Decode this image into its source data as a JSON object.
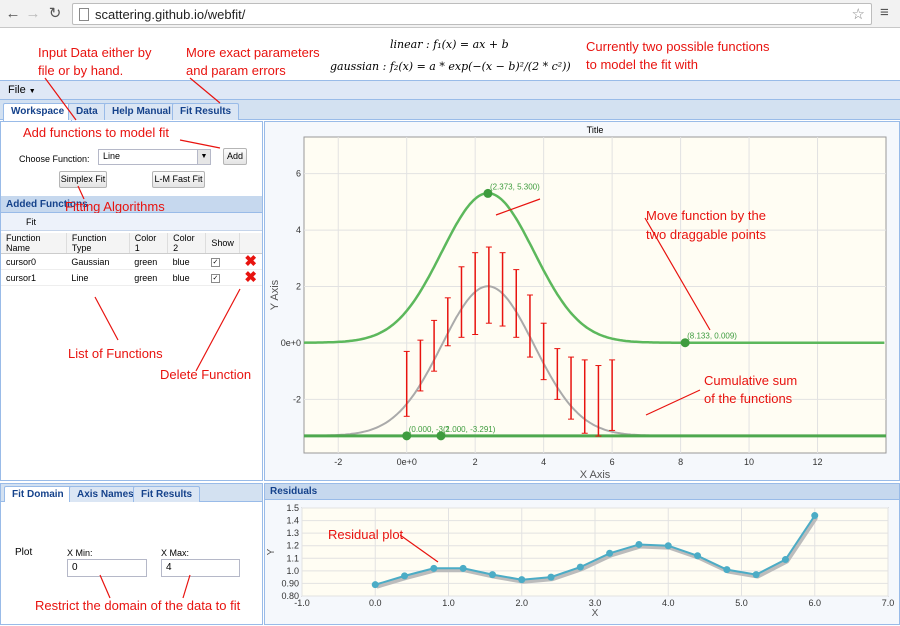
{
  "browser": {
    "url": "scattering.github.io/webfit/"
  },
  "formulas": {
    "linear": "linear : f₁(x) = ax + b",
    "gaussian": "gaussian : f₂(x) = a * exp(−(x − b)²/(2 * c²))"
  },
  "annotations": {
    "input_data_1": "Input Data either by",
    "input_data_2": "file or by hand.",
    "params_1": "More exact parameters",
    "params_2": "and param errors",
    "functions_1": "Currently two possible functions",
    "functions_2": "to model the fit with",
    "add_functions": "Add functions to model fit",
    "fitting_algorithms": "Fitting Algorithms",
    "list_functions": "List of Functions",
    "delete_function": "Delete Function",
    "move_function_1": "Move function by the",
    "move_function_2": "two draggable points",
    "cumulative_1": "Cumulative sum",
    "cumulative_2": "of the functions",
    "residual_plot": "Residual plot",
    "restrict_domain": "Restrict the domain of the data to fit"
  },
  "menu": {
    "file": "File"
  },
  "tabs": [
    "Workspace",
    "Data",
    "Help Manual",
    "Fit Results"
  ],
  "workspace": {
    "choose_function_label": "Choose Function:",
    "choose_function_value": "Line",
    "add_button": "Add",
    "simplex_button": "Simplex Fit",
    "lm_button": "L-M Fast Fit",
    "added_functions_title": "Added Functions",
    "fit_label": "Fit",
    "columns": [
      "Function Name",
      "Function Type",
      "Color 1",
      "Color 2",
      "Show"
    ],
    "rows": [
      {
        "name": "cursor0",
        "type": "Gaussian",
        "color1": "green",
        "color2": "blue"
      },
      {
        "name": "cursor1",
        "type": "Line",
        "color1": "green",
        "color2": "blue"
      }
    ]
  },
  "bottom_tabs": [
    "Fit Domain",
    "Axis Names",
    "Fit Results"
  ],
  "fit_domain": {
    "plot_label": "Plot",
    "xmin_label": "X Min:",
    "xmin_value": "0",
    "xmax_label": "X Max:",
    "xmax_value": "4"
  },
  "residuals_title": "Residuals",
  "colors": {
    "accent": "#15428b",
    "annotation": "#e8130f",
    "gaussian": "#5cb85c",
    "datapoints": "#e8130f",
    "residual": "#4bacc6"
  },
  "chart_data": [
    {
      "type": "scatter",
      "title": "Title",
      "xlabel": "X Axis",
      "ylabel": "Y Axis",
      "xlim": [
        -3,
        14
      ],
      "ylim": [
        -3.9,
        7.3
      ],
      "xticks": [
        "-2",
        "0e+0",
        "2",
        "4",
        "6",
        "8",
        "10",
        "12"
      ],
      "xtick_values": [
        -2,
        0,
        2,
        4,
        6,
        8,
        10,
        12
      ],
      "yticks": [
        "-2",
        "0e+0",
        "2",
        "4",
        "6"
      ],
      "ytick_values": [
        -2,
        0,
        2,
        4,
        6
      ],
      "grid": true,
      "errorbars": [
        {
          "x": 0.0,
          "ylow": -2.6,
          "yhigh": -0.3
        },
        {
          "x": 0.4,
          "ylow": -1.7,
          "yhigh": 0.1
        },
        {
          "x": 0.8,
          "ylow": -1.0,
          "yhigh": 0.8
        },
        {
          "x": 1.2,
          "ylow": -0.1,
          "yhigh": 1.6
        },
        {
          "x": 1.6,
          "ylow": 0.2,
          "yhigh": 2.7
        },
        {
          "x": 2.0,
          "ylow": 0.3,
          "yhigh": 3.2
        },
        {
          "x": 2.4,
          "ylow": 0.7,
          "yhigh": 3.4
        },
        {
          "x": 2.8,
          "ylow": 0.6,
          "yhigh": 3.2
        },
        {
          "x": 3.2,
          "ylow": 0.2,
          "yhigh": 2.6
        },
        {
          "x": 3.6,
          "ylow": -0.5,
          "yhigh": 1.7
        },
        {
          "x": 4.0,
          "ylow": -1.3,
          "yhigh": 0.7
        },
        {
          "x": 4.4,
          "ylow": -2.0,
          "yhigh": -0.2
        },
        {
          "x": 4.8,
          "ylow": -2.7,
          "yhigh": -0.5
        },
        {
          "x": 5.2,
          "ylow": -3.2,
          "yhigh": -0.6
        },
        {
          "x": 5.6,
          "ylow": -3.3,
          "yhigh": -0.8
        },
        {
          "x": 6.0,
          "ylow": -3.1,
          "yhigh": -0.6
        }
      ],
      "gaussian": {
        "a": 5.3,
        "b": 2.373,
        "c": 1.35,
        "offset": 0.009,
        "color": "#5cb85c"
      },
      "line": {
        "slope": 0.0,
        "intercept": -3.291,
        "color": "#4ea84e"
      },
      "cumulative": {
        "a": 5.3,
        "b": 2.373,
        "c": 1.35,
        "offset": -3.291,
        "color": "#aaaaaa"
      },
      "points": [
        {
          "x": 2.373,
          "y": 5.3,
          "label": "(2.373, 5.300)"
        },
        {
          "x": 8.133,
          "y": 0.009,
          "label": "(8.133, 0.009)"
        },
        {
          "x": 0.0,
          "y": -3.291,
          "label": "(0.000, -3.2"
        },
        {
          "x": 1.0,
          "y": -3.291,
          "label": "(1.000, -3.291)"
        }
      ]
    },
    {
      "type": "line",
      "title": "Residuals",
      "xlabel": "X",
      "ylabel": "Y",
      "xlim": [
        -1.0,
        7.0
      ],
      "ylim": [
        0.8,
        1.5
      ],
      "xticks": [
        "-1.0",
        "0.0",
        "1.0",
        "2.0",
        "3.0",
        "4.0",
        "5.0",
        "6.0",
        "7.0"
      ],
      "xtick_values": [
        -1,
        0,
        1,
        2,
        3,
        4,
        5,
        6,
        7
      ],
      "yticks": [
        "0.80",
        "0.90",
        "1.0",
        "1.1",
        "1.2",
        "1.3",
        "1.4",
        "1.5"
      ],
      "ytick_values": [
        0.8,
        0.9,
        1.0,
        1.1,
        1.2,
        1.3,
        1.4,
        1.5
      ],
      "grid": true,
      "x": [
        0.0,
        0.4,
        0.8,
        1.2,
        1.6,
        2.0,
        2.4,
        2.8,
        3.2,
        3.6,
        4.0,
        4.4,
        4.8,
        5.2,
        5.6,
        6.0
      ],
      "values": [
        0.89,
        0.96,
        1.02,
        1.02,
        0.97,
        0.93,
        0.95,
        1.03,
        1.14,
        1.21,
        1.2,
        1.12,
        1.01,
        0.97,
        1.09,
        1.44
      ]
    }
  ]
}
